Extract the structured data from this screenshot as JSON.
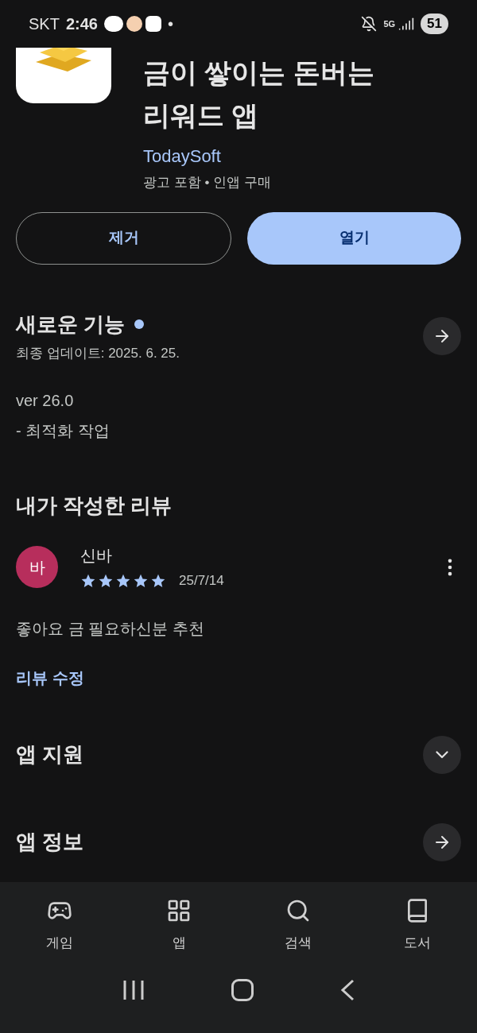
{
  "status_bar": {
    "carrier": "SKT",
    "time": "2:46",
    "notification_dot": "•",
    "network": "5G",
    "battery": "51"
  },
  "app": {
    "title_lines": [
      "금이 쌓이는 돈버는",
      "리워드 앱"
    ],
    "developer": "TodaySoft",
    "info": "광고 포함 • 인앱 구매"
  },
  "buttons": [
    {
      "label": "제거",
      "kind": "outlined"
    },
    {
      "label": "열기",
      "kind": "filled"
    }
  ],
  "whats_new": {
    "title": "새로운 기능",
    "updated": "최종 업데이트: 2025. 6. 25.",
    "lines": [
      "ver 26.0",
      "- 최적화 작업"
    ]
  },
  "my_review": {
    "title": "내가 작성한 리뷰",
    "avatar": "바",
    "author": "신바",
    "stars": 5,
    "date": "25/7/14",
    "text": "좋아요 금 필요하신분 추천",
    "edit_link": "리뷰 수정"
  },
  "sections": [
    {
      "title": "앱 지원",
      "kind": "expand"
    },
    {
      "title": "앱 정보",
      "kind": "arrow"
    }
  ],
  "nav": [
    {
      "label": "게임",
      "kind": "games",
      "selected": false
    },
    {
      "label": "앱",
      "kind": "apps",
      "selected": false
    },
    {
      "label": "검색",
      "kind": "search",
      "selected": false
    },
    {
      "label": "도서",
      "kind": "books",
      "selected": false
    }
  ]
}
